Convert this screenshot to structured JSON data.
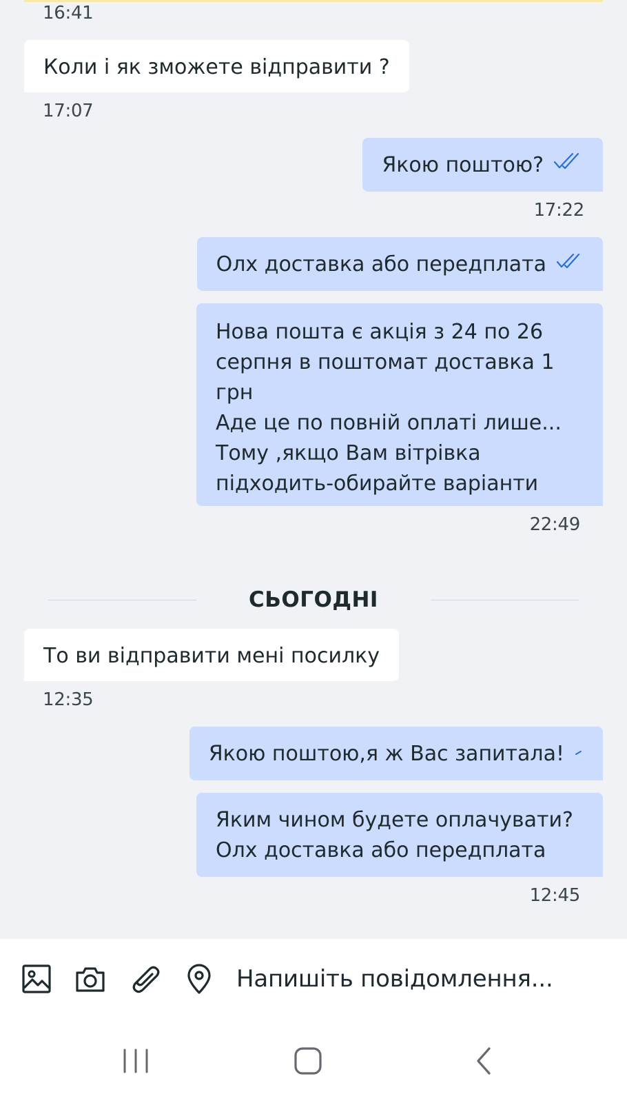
{
  "messages": [
    {
      "time": "16:41"
    },
    {
      "text": "Коли і як зможете відправити ?",
      "time": "17:07"
    },
    {
      "text": "Якою поштою?",
      "time": ""
    },
    {
      "text": "",
      "time": "17:22"
    },
    {
      "text": "Олх доставка або передплата",
      "time": ""
    },
    {
      "text": "Нова пошта є акція з 24 по 26\nсерпня в поштомат доставка 1\nгрн\nАде це по повній оплаті лише...\nТому ,якщо Вам вітрівка\nпідходить-обирайте варіанти",
      "time": "22:49"
    },
    {
      "text": "То ви відправити мені посилку",
      "time": "12:35"
    },
    {
      "text": "Якою поштою,я ж Вас запитала!",
      "time": ""
    },
    {
      "text": "Яким чином будете оплачувати?\nОлх доставка або передплата",
      "time": "12:45"
    }
  ],
  "day_separator": "СЬОГОДНІ",
  "composer": {
    "placeholder": "Напишіть повідомлення...",
    "icons": [
      "image-icon",
      "camera-icon",
      "paperclip-icon",
      "location-pin-icon"
    ]
  },
  "navbar": {
    "icons": [
      "recent-apps-icon",
      "home-icon",
      "back-icon"
    ]
  },
  "colors": {
    "background": "#f1f2f5",
    "incoming_bubble": "#ffffff",
    "outgoing_bubble": "#ccdcff",
    "read_tick": "#2a6fd6"
  }
}
